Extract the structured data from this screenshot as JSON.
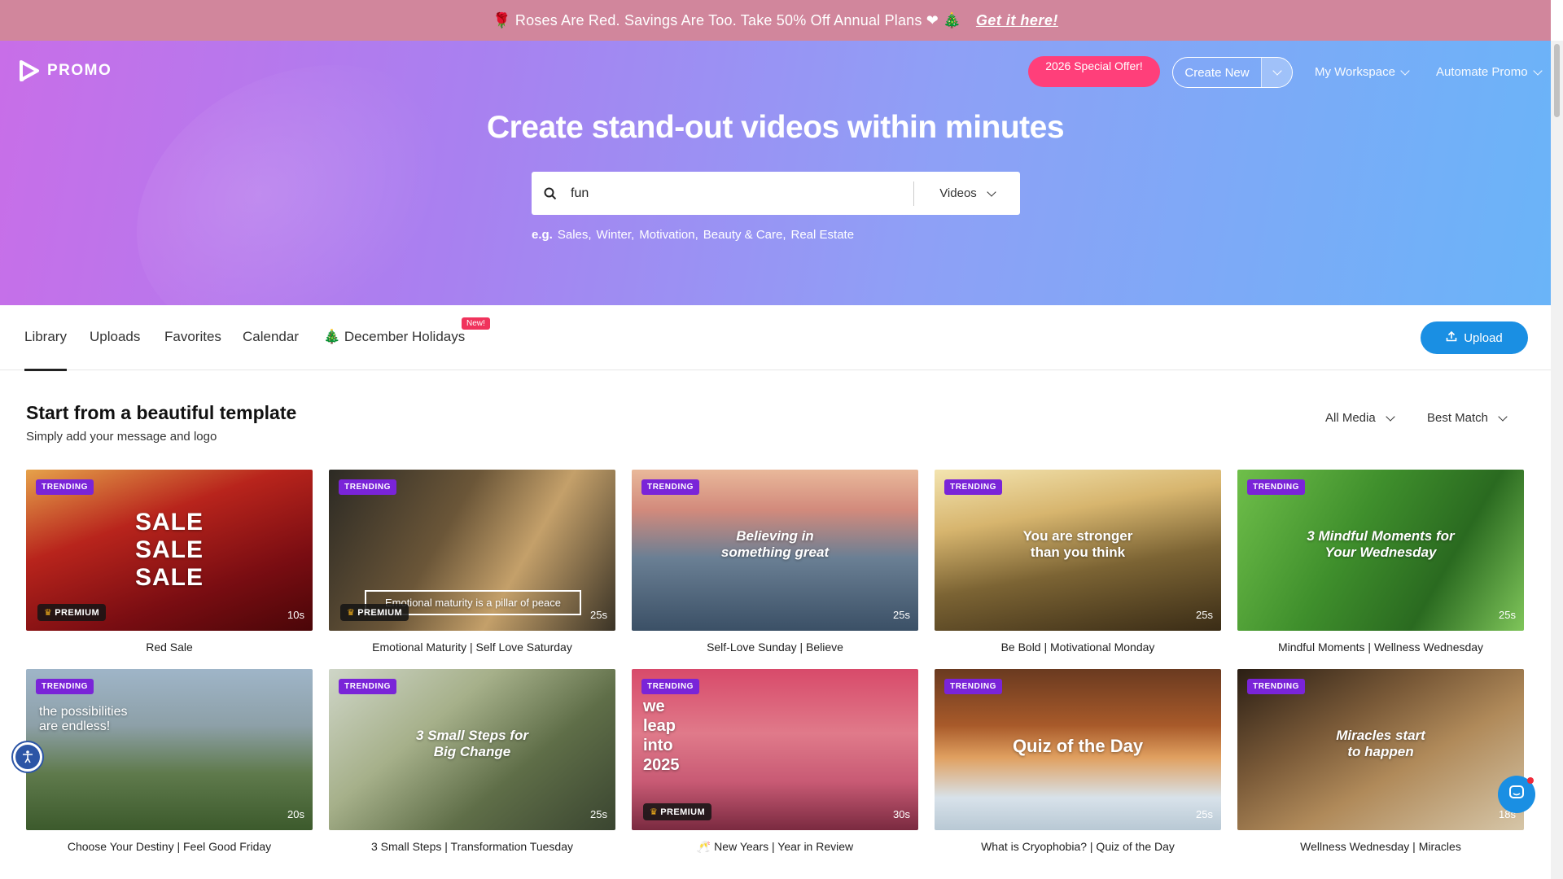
{
  "banner": {
    "message": "🌹 Roses Are Red. Savings Are Too. Take 50% Off Annual Plans ❤ 🎄",
    "cta": "Get it here!"
  },
  "header": {
    "brand": "PROMO",
    "special_offer": "2026 Special Offer!",
    "create_new": "Create New",
    "my_workspace": "My Workspace",
    "automate": "Automate Promo"
  },
  "hero": {
    "headline": "Create stand-out videos within minutes",
    "search_value": "fun",
    "search_type": "Videos",
    "eg_label": "e.g.",
    "examples": [
      "Sales,",
      "Winter,",
      "Motivation,",
      "Beauty & Care,",
      "Real Estate"
    ]
  },
  "tabs": {
    "items": [
      "Library",
      "Uploads",
      "Favorites",
      "Calendar",
      "🎄 December Holidays"
    ],
    "new_badge": "New!",
    "upload": "Upload"
  },
  "section": {
    "title": "Start from a beautiful template",
    "subtitle": "Simply add your message and logo",
    "filter_media": "All Media",
    "filter_sort": "Best Match"
  },
  "cards": [
    {
      "title": "Red Sale",
      "badge": "TRENDING",
      "duration": "10s",
      "premium": "PREMIUM",
      "overlay": "SALE\nSALE\nSALE",
      "bg": "linear-gradient(160deg,#e6a24a 0%,#b8241c 35%,#7a0d12 70%,#4a0608 100%)"
    },
    {
      "title": "Emotional Maturity | Self Love Saturday",
      "badge": "TRENDING",
      "duration": "25s",
      "premium": "PREMIUM",
      "overlay": "Emotional maturity is a pillar of peace",
      "bg": "linear-gradient(120deg,#2c2a24 0%,#6b5638 40%,#c4a06a 65%,#3a3326 100%)"
    },
    {
      "title": "Self-Love Sunday | Believe",
      "badge": "TRENDING",
      "duration": "25s",
      "premium": "",
      "overlay": "Believing in\nsomething great",
      "bg": "linear-gradient(180deg,#e9b89a 0%,#d28a7c 25%,#6a7f94 55%,#3b5066 100%)"
    },
    {
      "title": "Be Bold | Motivational Monday",
      "badge": "TRENDING",
      "duration": "25s",
      "premium": "",
      "overlay": "You are stronger\nthan you think",
      "bg": "linear-gradient(170deg,#f3e4b0 0%,#d7b56e 30%,#7c6434 60%,#3a2c16 100%)"
    },
    {
      "title": "Mindful Moments | Wellness Wednesday",
      "badge": "TRENDING",
      "duration": "25s",
      "premium": "",
      "overlay": "3 Mindful Moments for\nYour Wednesday",
      "bg": "linear-gradient(120deg,#6fbf4a 0%,#3f8f2c 40%,#2a6a20 70%,#7fc55a 100%)"
    },
    {
      "title": "Choose Your Destiny | Feel Good Friday",
      "badge": "TRENDING",
      "duration": "20s",
      "premium": "",
      "overlay": "the possibilities\nare endless!",
      "bg": "linear-gradient(180deg,#9fb5c8 0%,#8da0a8 35%,#5f7a4c 65%,#3c5a2c 100%)"
    },
    {
      "title": "3 Small Steps | Transformation Tuesday",
      "badge": "TRENDING",
      "duration": "25s",
      "premium": "",
      "overlay": "3 Small Steps for\nBig Change",
      "bg": "linear-gradient(140deg,#cfd6c8 0%,#a6b08a 35%,#5f6e48 65%,#3a4530 100%)"
    },
    {
      "title": "🥂 New Years | Year in Review",
      "badge": "TRENDING",
      "duration": "30s",
      "premium": "PREMIUM",
      "overlay": "we\nleap\ninto\n2025",
      "bg": "linear-gradient(180deg,#d84a6a 0%,#e07a8a 40%,#c85a74 70%,#7a2a40 100%)"
    },
    {
      "title": "What is Cryophobia? | Quiz of the Day",
      "badge": "TRENDING",
      "duration": "25s",
      "premium": "",
      "overlay": "Quiz of the Day",
      "bg": "linear-gradient(180deg,#6a3a20 0%,#a85a2a 35%,#e0a060 55%,#d8e2ea 80%,#b8c8d4 100%)"
    },
    {
      "title": "Wellness Wednesday | Miracles",
      "badge": "TRENDING",
      "duration": "18s",
      "premium": "",
      "overlay": "Miracles start\nto happen",
      "bg": "linear-gradient(150deg,#2a1e14 0%,#7a5a38 35%,#b08a5a 60%,#d6c6a8 100%)"
    }
  ],
  "colors": {
    "banner": "#d1869c",
    "accent": "#1a8fe3",
    "special": "#ff3f7a",
    "trending": "#7a24d8"
  }
}
